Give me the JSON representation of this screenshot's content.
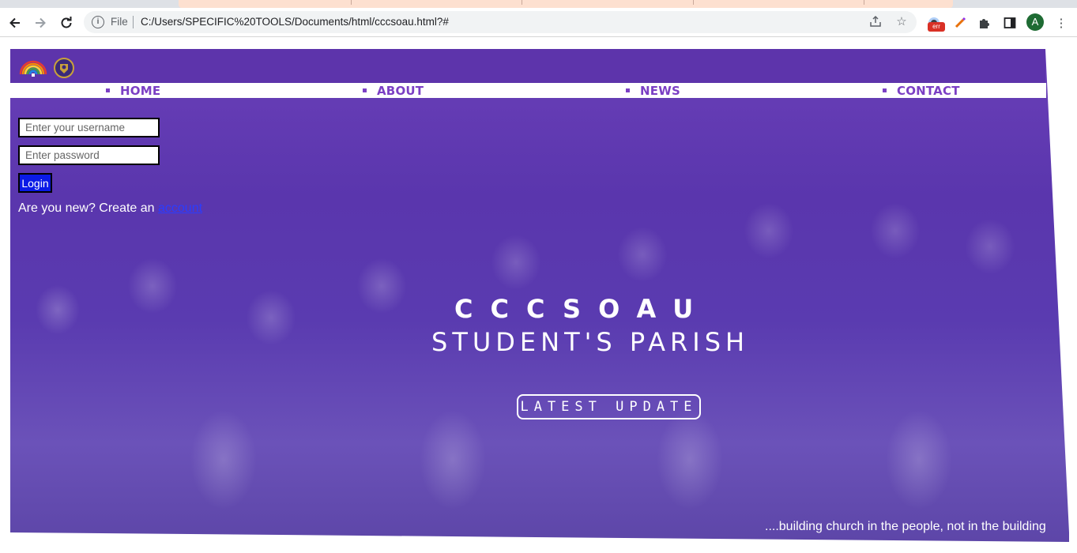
{
  "browser": {
    "file_label": "File",
    "url": "C:/Users/SPECIFIC%20TOOLS/Documents/html/cccsoau.html?#",
    "extension_badge": "err",
    "profile_initial": "A",
    "icons": {
      "back": "back-arrow-icon",
      "forward": "forward-arrow-icon",
      "reload": "reload-icon",
      "info": "info-icon",
      "share": "share-icon",
      "bookmark": "star-icon",
      "extensions": "puzzle-icon",
      "sidepanel": "side-panel-icon",
      "menu": "kebab-menu-icon"
    }
  },
  "site": {
    "colors": {
      "banner": "#5d34ab",
      "nav_text": "#7b3fc4",
      "login_button": "#0a1ae6"
    },
    "nav": [
      {
        "label": "HOME"
      },
      {
        "label": "ABOUT"
      },
      {
        "label": "NEWS"
      },
      {
        "label": "CONTACT"
      }
    ],
    "login": {
      "username_placeholder": "Enter your username",
      "password_placeholder": "Enter password",
      "button_label": "Login",
      "new_prefix": "Are you new? Create an ",
      "new_link": "account"
    },
    "hero": {
      "title": "CCCSOAU",
      "subtitle": "STUDENT'S PARISH",
      "button_label": "LATEST UPDATE",
      "tagline": "....building church in the people, not in the building"
    }
  }
}
